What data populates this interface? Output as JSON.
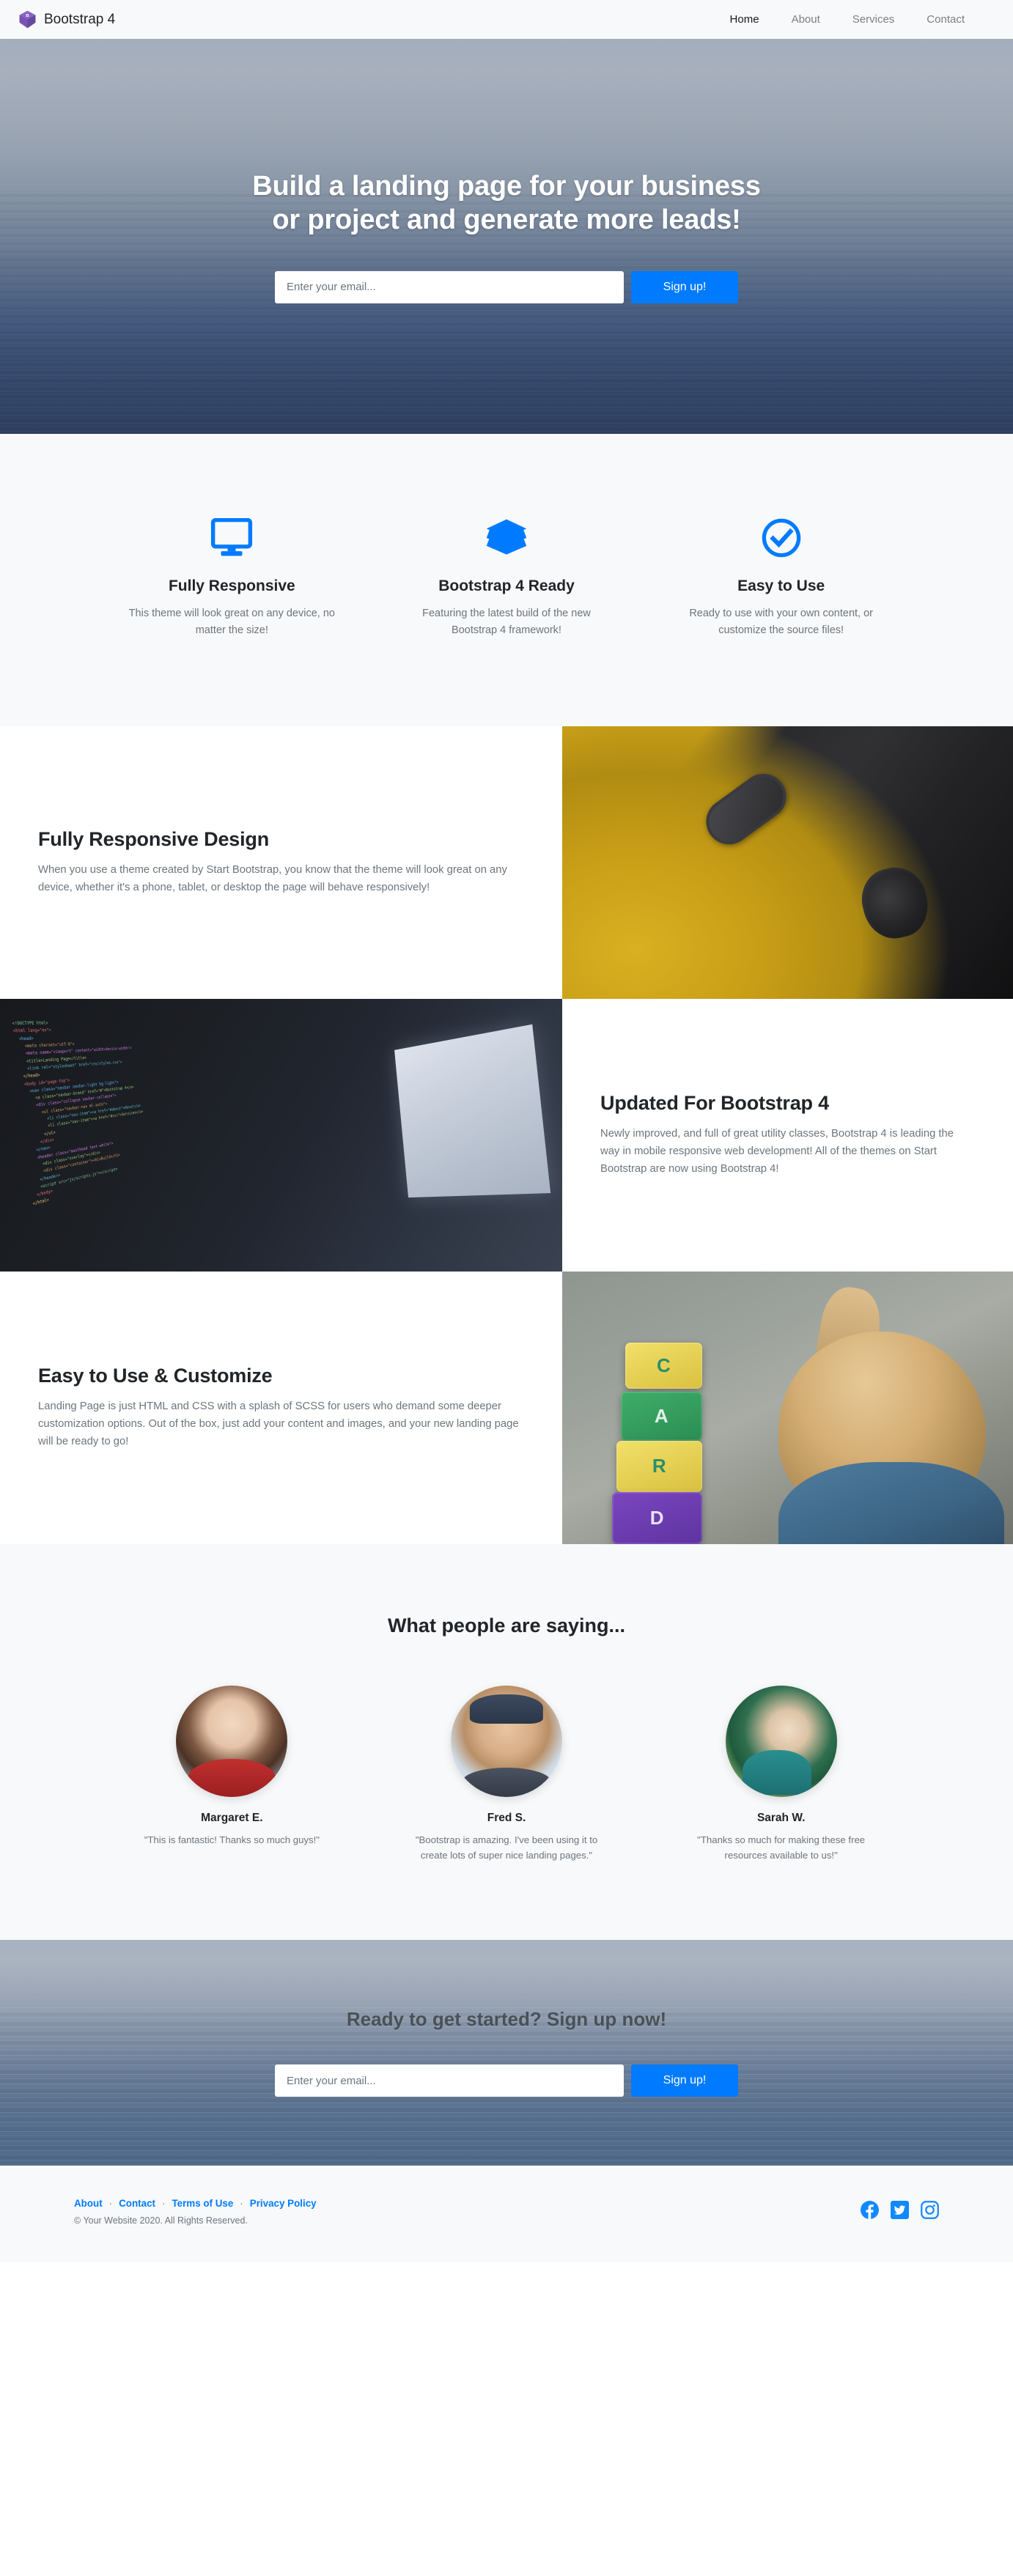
{
  "navbar": {
    "brand": "Bootstrap 4",
    "brand_logo_icon": "bootstrap-logo-icon",
    "links": [
      {
        "label": "Home",
        "active": true
      },
      {
        "label": "About",
        "active": false
      },
      {
        "label": "Services",
        "active": false
      },
      {
        "label": "Contact",
        "active": false
      }
    ]
  },
  "hero": {
    "heading_line1": "Build a landing page for your business",
    "heading_line2": "or project and generate more leads!",
    "email_placeholder": "Enter your email...",
    "email_value": "",
    "signup_label": "Sign up!",
    "signup_color": "#007bff"
  },
  "features": [
    {
      "icon": "desktop-monitor-icon",
      "title": "Fully Responsive",
      "text": "This theme will look great on any device, no matter the size!"
    },
    {
      "icon": "layers-stack-icon",
      "title": "Bootstrap 4 Ready",
      "text": "Featuring the latest build of the new Bootstrap 4 framework!"
    },
    {
      "icon": "check-circle-icon",
      "title": "Easy to Use",
      "text": "Ready to use with your own content, or customize the source files!"
    }
  ],
  "showcase": [
    {
      "title": "Fully Responsive Design",
      "text": "When you use a theme created by Start Bootstrap, you know that the theme will look great on any device, whether it's a phone, tablet, or desktop the page will behave responsively!",
      "image_alt": "black iphone on yellow background"
    },
    {
      "title": "Updated For Bootstrap 4",
      "text": "Newly improved, and full of great utility classes, Bootstrap 4 is leading the way in mobile responsive web development! All of the themes on Start Bootstrap are now using Bootstrap 4!",
      "image_alt": "colorful source code on a dark monitor"
    },
    {
      "title": "Easy to Use & Customize",
      "text": "Landing Page is just HTML and CSS with a splash of SCSS for users who demand some deeper customization options. Out of the box, just add your content and images, and your new landing page will be ready to go!",
      "image_alt": "toddler stacking alphabet blocks"
    }
  ],
  "testimonials": {
    "heading": "What people are saying...",
    "items": [
      {
        "name": "Margaret E.",
        "quote": "\"This is fantastic! Thanks so much guys!\"",
        "avatar": "avatar-margaret"
      },
      {
        "name": "Fred S.",
        "quote": "\"Bootstrap is amazing. I've been using it to create lots of super nice landing pages.\"",
        "avatar": "avatar-fred"
      },
      {
        "name": "Sarah W.",
        "quote": "\"Thanks so much for making these free resources available to us!\"",
        "avatar": "avatar-sarah"
      }
    ]
  },
  "cta": {
    "heading": "Ready to get started? Sign up now!",
    "email_placeholder": "Enter your email...",
    "email_value": "",
    "signup_label": "Sign up!"
  },
  "footer": {
    "links": [
      {
        "label": "About"
      },
      {
        "label": "Contact"
      },
      {
        "label": "Terms of Use"
      },
      {
        "label": "Privacy Policy"
      }
    ],
    "separator": "·",
    "copyright": "© Your Website 2020. All Rights Reserved.",
    "link_color": "#007bff",
    "socials": [
      {
        "icon": "facebook-icon"
      },
      {
        "icon": "twitter-icon"
      },
      {
        "icon": "instagram-icon"
      }
    ]
  }
}
